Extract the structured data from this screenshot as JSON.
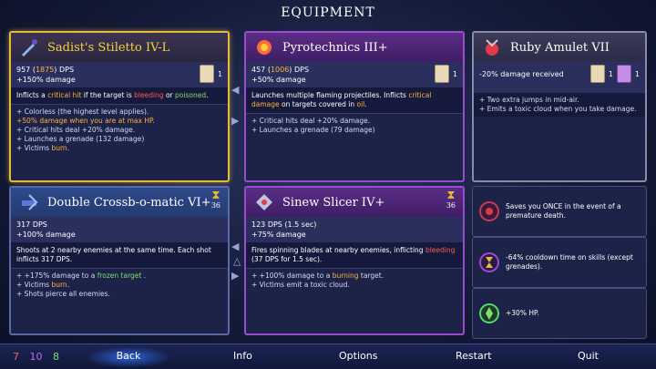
{
  "title": "EQUIPMENT",
  "colors": {
    "gold": "#f4d23c",
    "green": "#7de06a",
    "red": "#ff5a5a",
    "orange": "#ffb23a"
  },
  "weapon1": {
    "name": "Sadist's Stiletto IV-L",
    "dps_a": "957 (",
    "dps_b": "1875",
    "dps_c": ") DPS",
    "damage": "+150% damage",
    "scroll_count": "1",
    "desc_a": "Inflicts a ",
    "desc_b": "critical hit",
    "desc_c": " if the target is ",
    "desc_d": "bleeding",
    "desc_e": " or ",
    "desc_f": "poisoned",
    "desc_g": ".",
    "mods": [
      "+ Colorless (the highest level applies).",
      "+50% damage when you are at max HP.",
      "+ Critical hits deal +20% damage.",
      "+ Launches a grenade (132 damage)"
    ],
    "mod_last_a": "+ Victims ",
    "mod_last_b": "burn",
    "mod_last_c": "."
  },
  "weapon2": {
    "name": "Pyrotechnics III+",
    "dps_a": "457 (",
    "dps_b": "1006",
    "dps_c": ") DPS",
    "damage": "+50% damage",
    "scroll_count": "1",
    "desc_a": "Launches multiple flaming projectiles. Inflicts ",
    "desc_b": "critical damage",
    "desc_c": " on targets covered in ",
    "desc_d": "oil",
    "desc_e": ".",
    "mods": [
      "+ Critical hits deal +20% damage.",
      "+ Launches a grenade (79 damage)"
    ]
  },
  "amulet": {
    "name": "Ruby Amulet VII",
    "stat": "-20% damage received",
    "scroll1": "1",
    "scroll2": "1",
    "mods": [
      "+ Two extra jumps in mid-air.",
      "+ Emits a toxic cloud when you take damage."
    ]
  },
  "skill1": {
    "name": "Double Crossb-o-matic VI+",
    "cooldown": "36",
    "dps": "317 DPS",
    "damage": "+100% damage",
    "desc": "Shoots at 2 nearby enemies at the same time. Each shot inflicts 317 DPS.",
    "mod1_a": "+ +175% damage to a ",
    "mod1_b": "frozen target",
    "mod1_c": " .",
    "mod2_a": "+ Victims ",
    "mod2_b": "burn",
    "mod2_c": ".",
    "mod3": "+ Shots pierce all enemies."
  },
  "skill2": {
    "name": "Sinew Slicer IV+",
    "cooldown": "36",
    "dps": "123 DPS (1.5 sec)",
    "damage": "+75% damage",
    "desc_a": "Fires spinning blades at nearby enemies, inflicting ",
    "desc_b": "bleeding",
    "desc_c": " (37 DPS for 1.5 sec).",
    "mod1_a": "+ +100% damage to a ",
    "mod1_b": "burning",
    "mod1_c": " target.",
    "mod2": "+ Victims emit a toxic cloud."
  },
  "mutations": [
    {
      "text": "Saves you ONCE in the event of a premature death."
    },
    {
      "text": "-64% cooldown time on skills (except grenades)."
    },
    {
      "text": "+30% HP."
    }
  ],
  "bottom": {
    "scrolls_red": "7",
    "scrolls_purple": "10",
    "scrolls_green": "8",
    "back": "Back",
    "info": "Info",
    "options": "Options",
    "restart": "Restart",
    "quit": "Quit"
  }
}
